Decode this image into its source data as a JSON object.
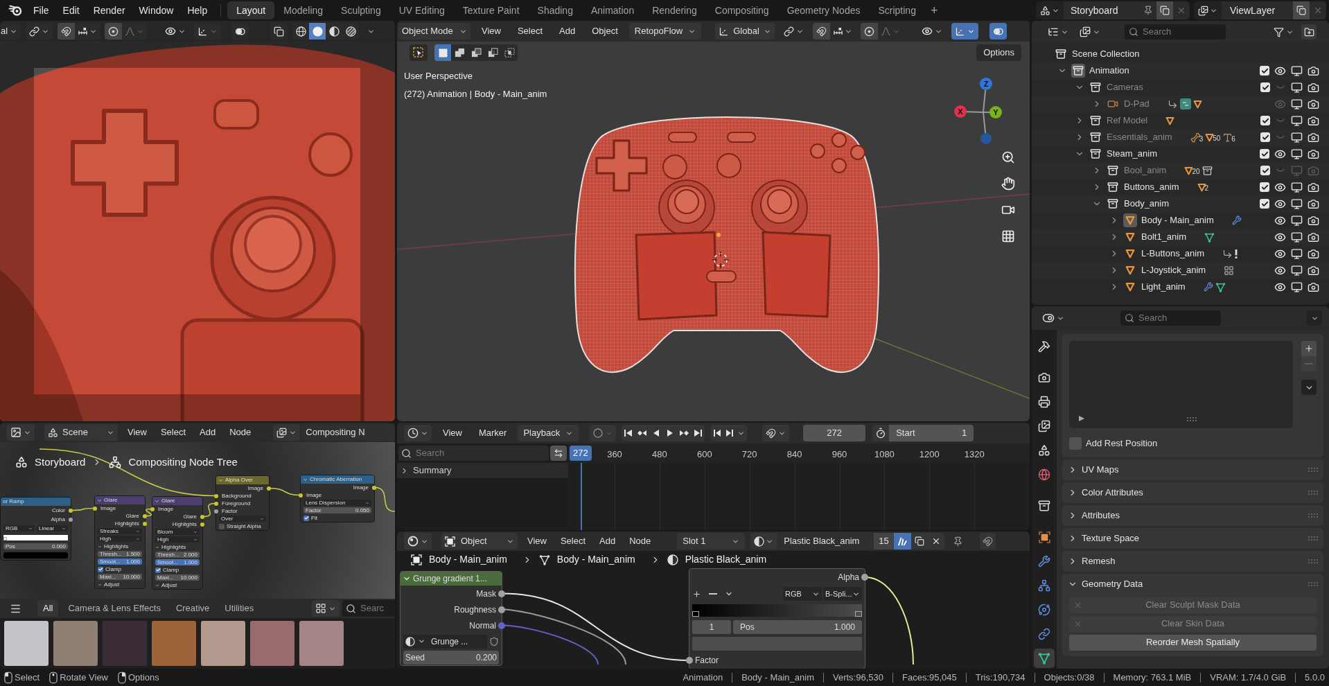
{
  "top_bar": {
    "menus": [
      "File",
      "Edit",
      "Render",
      "Window",
      "Help"
    ],
    "workspaces": [
      {
        "label": "Layout",
        "selected": true
      },
      {
        "label": "Modeling",
        "selected": false
      },
      {
        "label": "Sculpting",
        "selected": false
      },
      {
        "label": "UV Editing",
        "selected": false
      },
      {
        "label": "Texture Paint",
        "selected": false
      },
      {
        "label": "Shading",
        "selected": false
      },
      {
        "label": "Animation",
        "selected": false
      },
      {
        "label": "Rendering",
        "selected": false
      },
      {
        "label": "Compositing",
        "selected": false
      },
      {
        "label": "Geometry Nodes",
        "selected": false
      },
      {
        "label": "Scripting",
        "selected": false
      }
    ],
    "add_workspace": "+",
    "scene": "Storyboard",
    "view_layer": "ViewLayer"
  },
  "camera_view": {
    "orientation": "al",
    "gizmo": false,
    "overlays": false,
    "shading": [
      {
        "kind": "wireframe",
        "selected": false
      },
      {
        "kind": "solid",
        "selected": true
      },
      {
        "kind": "material",
        "selected": false
      },
      {
        "kind": "rendered",
        "selected": false
      }
    ]
  },
  "viewport": {
    "mode": "Object Mode",
    "menus": [
      "View",
      "Select",
      "Add",
      "Object"
    ],
    "addon": "RetopoFlow",
    "orientation": "Global",
    "gizmo": true,
    "overlays": true,
    "select_modes": [
      {
        "kind": "set",
        "selected": true
      },
      {
        "kind": "extend",
        "selected": false
      },
      {
        "kind": "subtract",
        "selected": false
      },
      {
        "kind": "invert",
        "selected": false
      },
      {
        "kind": "intersect",
        "selected": false
      }
    ],
    "options": "Options",
    "view_name": "User Perspective",
    "info": "(272) Animation | Body - Main_anim",
    "axes": [
      {
        "label": "Z",
        "color": "#2f76dc"
      },
      {
        "label": "X",
        "color": "#e0314d"
      },
      {
        "label": "Y",
        "color": "#7ab317"
      }
    ]
  },
  "outliner": {
    "search": {
      "placeholder": "Search"
    },
    "tree": [
      {
        "label": "Scene Collection",
        "kind": "scene_collection",
        "selected": false,
        "children": [
          {
            "label": "Animation",
            "kind": "collection",
            "selected": true,
            "expanded": true,
            "checked": true,
            "visible": true,
            "renderable": true,
            "children": [
              {
                "label": "Cameras",
                "kind": "collection",
                "selected": false,
                "expanded": true,
                "checked": true,
                "visible": false,
                "renderable": true,
                "children": [
                  {
                    "label": "D-Pad",
                    "kind": "camera",
                    "selected": false,
                    "expanded": false,
                    "visible": false,
                    "renderable": true,
                    "extras": [
                      {
                        "kind": "constraint"
                      },
                      {
                        "kind": "camera_data"
                      },
                      {
                        "kind": "mesh"
                      }
                    ]
                  }
                ]
              },
              {
                "label": "Ref Model",
                "kind": "collection",
                "selected": false,
                "expanded": false,
                "checked": true,
                "visible": false,
                "renderable": true,
                "extras": [
                  {
                    "kind": "mesh"
                  }
                ]
              },
              {
                "label": "Essentials_anim",
                "kind": "collection",
                "selected": false,
                "expanded": false,
                "checked": true,
                "visible": false,
                "renderable": true,
                "extras": [
                  {
                    "kind": "armature",
                    "count": "3"
                  },
                  {
                    "kind": "mesh",
                    "count": "50"
                  },
                  {
                    "kind": "text",
                    "count": "6"
                  }
                ]
              },
              {
                "label": "Steam_anim",
                "kind": "collection",
                "selected": false,
                "expanded": true,
                "checked": true,
                "visible": true,
                "renderable": true,
                "children": [
                  {
                    "label": "Bool_anim",
                    "kind": "collection",
                    "selected": false,
                    "expanded": false,
                    "checked": true,
                    "visible": false,
                    "renderable": false,
                    "extras": [
                      {
                        "kind": "mesh",
                        "count": "20"
                      },
                      {
                        "kind": "collection"
                      }
                    ]
                  },
                  {
                    "label": "Buttons_anim",
                    "kind": "collection",
                    "selected": false,
                    "expanded": false,
                    "checked": true,
                    "visible": true,
                    "renderable": true,
                    "extras": [
                      {
                        "kind": "mesh",
                        "count": "2"
                      }
                    ]
                  },
                  {
                    "label": "Body_anim",
                    "kind": "collection",
                    "selected": false,
                    "expanded": true,
                    "checked": true,
                    "visible": true,
                    "renderable": true,
                    "children": [
                      {
                        "label": "Body - Main_anim",
                        "kind": "mesh_object",
                        "selected": true,
                        "expanded": false,
                        "visible": true,
                        "renderable": true,
                        "extras": [
                          {
                            "kind": "modifier"
                          }
                        ]
                      },
                      {
                        "label": "Bolt1_anim",
                        "kind": "mesh_object",
                        "selected": false,
                        "expanded": false,
                        "visible": true,
                        "renderable": true,
                        "extras": [
                          {
                            "kind": "mesh_data"
                          }
                        ]
                      },
                      {
                        "label": "L-Buttons_anim",
                        "kind": "mesh_object",
                        "selected": false,
                        "expanded": false,
                        "visible": true,
                        "renderable": true,
                        "extras": [
                          {
                            "kind": "constraint"
                          },
                          {
                            "kind": "warning"
                          }
                        ]
                      },
                      {
                        "label": "L-Joystick_anim",
                        "kind": "mesh_object",
                        "selected": false,
                        "expanded": false,
                        "visible": true,
                        "renderable": true,
                        "extras": [
                          {
                            "kind": "nodes"
                          }
                        ]
                      },
                      {
                        "label": "Light_anim",
                        "kind": "mesh_object",
                        "selected": false,
                        "expanded": false,
                        "visible": true,
                        "renderable": true,
                        "extras": [
                          {
                            "kind": "modifier"
                          },
                          {
                            "kind": "mesh_data"
                          }
                        ]
                      }
                    ]
                  }
                ]
              }
            ]
          }
        ]
      }
    ]
  },
  "properties": {
    "search": {
      "placeholder": "Search"
    },
    "tabs": [
      {
        "kind": "tool",
        "selected": false
      },
      {
        "kind": "render",
        "selected": false
      },
      {
        "kind": "output",
        "selected": false
      },
      {
        "kind": "view_layer",
        "selected": false
      },
      {
        "kind": "scene",
        "selected": false
      },
      {
        "kind": "world",
        "selected": false
      },
      {
        "kind": "collection",
        "selected": false
      },
      {
        "kind": "object",
        "selected": false
      },
      {
        "kind": "modifiers",
        "selected": false
      },
      {
        "kind": "particles",
        "selected": false
      },
      {
        "kind": "physics",
        "selected": false
      },
      {
        "kind": "constraints",
        "selected": false
      },
      {
        "kind": "data",
        "selected": true
      }
    ],
    "rest_position": {
      "label": "Add Rest Position",
      "checked": false
    },
    "panels": [
      {
        "label": "UV Maps",
        "expanded": false
      },
      {
        "label": "Color Attributes",
        "expanded": false
      },
      {
        "label": "Attributes",
        "expanded": false
      },
      {
        "label": "Texture Space",
        "expanded": false
      },
      {
        "label": "Remesh",
        "expanded": false
      },
      {
        "label": "Geometry Data",
        "expanded": true,
        "buttons": [
          {
            "label": "Clear Sculpt Mask Data",
            "disabled": true
          },
          {
            "label": "Clear Skin Data",
            "disabled": true
          },
          {
            "label": "Reorder Mesh Spatially",
            "disabled": false
          }
        ]
      }
    ]
  },
  "compositor": {
    "scene": "Scene",
    "menus": [
      "View",
      "Select",
      "Add",
      "Node"
    ],
    "tree": "Compositing N",
    "breadcrumb": [
      {
        "kind": "scene",
        "label": "Storyboard"
      },
      {
        "kind": "node_tree",
        "label": "Compositing Node Tree"
      }
    ],
    "nodes": [
      {
        "title": "or Ramp",
        "color": "#2e5f87",
        "rows": [
          {
            "kind": "output",
            "label": "Color",
            "color": "#c7c729"
          },
          {
            "kind": "output",
            "label": "Alpha",
            "color": "#a1a1a1"
          },
          {
            "kind": "dropdowns",
            "labels": [
              "RGB",
              "Linear"
            ]
          },
          {
            "kind": "ramp",
            "stops": [
              {
                "color": "#ffffff"
              }
            ]
          },
          {
            "kind": "field",
            "label": "Pos",
            "value": "0.000",
            "highlight": false
          },
          {
            "kind": "swatch",
            "color": "#000000"
          }
        ]
      },
      {
        "title": "Glare",
        "color": "#4c3f6e",
        "rows": [
          {
            "kind": "input",
            "label": "Image",
            "color": "#c7c729"
          },
          {
            "kind": "output",
            "label": "Glare",
            "color": "#c7c729"
          },
          {
            "kind": "output",
            "label": "Highlights",
            "color": "#c7c729"
          },
          {
            "kind": "dropdown",
            "label": "Streaks"
          },
          {
            "kind": "dropdown",
            "label": "High"
          },
          {
            "kind": "panel",
            "label": "Highlights",
            "expanded": true
          },
          {
            "kind": "field",
            "label": "Thresh...",
            "value": "1.500",
            "highlight": false
          },
          {
            "kind": "field",
            "label": "Smoot...",
            "value": "1.000",
            "highlight": true
          },
          {
            "kind": "checkbox",
            "label": "Clamp",
            "checked": true
          },
          {
            "kind": "field",
            "label": "Maxi...",
            "value": "10.000",
            "highlight": false
          },
          {
            "kind": "panel",
            "label": "Adjust",
            "expanded": true
          }
        ]
      },
      {
        "title": "Glare",
        "color": "#4c3f6e",
        "rows": [
          {
            "kind": "input",
            "label": "Image",
            "color": "#c7c729"
          },
          {
            "kind": "output",
            "label": "Glare",
            "color": "#c7c729"
          },
          {
            "kind": "output",
            "label": "Highlights",
            "color": "#c7c729"
          },
          {
            "kind": "dropdown",
            "label": "Bloom"
          },
          {
            "kind": "dropdown",
            "label": "High"
          },
          {
            "kind": "panel",
            "label": "Highlights",
            "expanded": true
          },
          {
            "kind": "field",
            "label": "Thresh...",
            "value": "2.000",
            "highlight": false
          },
          {
            "kind": "field",
            "label": "Smoot...",
            "value": "1.000",
            "highlight": true
          },
          {
            "kind": "checkbox",
            "label": "Clamp",
            "checked": true
          },
          {
            "kind": "field",
            "label": "Maxi...",
            "value": "10.000",
            "highlight": false
          },
          {
            "kind": "panel",
            "label": "Adjust",
            "expanded": true
          }
        ]
      },
      {
        "title": "Alpha Over",
        "color": "#6b6a2c",
        "rows": [
          {
            "kind": "output",
            "label": "Image",
            "color": "#c7c729"
          },
          {
            "kind": "input",
            "label": "Background",
            "color": "#c7c729"
          },
          {
            "kind": "input",
            "label": "Foreground",
            "color": "#c7c729"
          },
          {
            "kind": "input",
            "label": "Factor",
            "color": "#a1a1a1"
          },
          {
            "kind": "dropdown",
            "label": "Over"
          },
          {
            "kind": "checkbox",
            "label": "Straight Alpha",
            "checked": false
          }
        ]
      },
      {
        "title": "Chromatic Aberration",
        "color": "#2e5f87",
        "rows": [
          {
            "kind": "output",
            "label": "Image",
            "color": "#c7c729"
          },
          {
            "kind": "input",
            "label": "Image",
            "color": "#c7c729"
          },
          {
            "kind": "dropdown",
            "label": "Lens Dispersion"
          },
          {
            "kind": "field",
            "label": "Factor",
            "value": "0.050",
            "highlight": false
          },
          {
            "kind": "checkbox",
            "label": "Fit",
            "checked": true
          }
        ]
      }
    ]
  },
  "asset_browser": {
    "categories": [
      {
        "label": "All",
        "selected": true
      },
      {
        "label": "Camera & Lens Effects",
        "selected": false
      },
      {
        "label": "Creative",
        "selected": false
      },
      {
        "label": "Utilities",
        "selected": false
      }
    ],
    "search": {
      "placeholder": "Searc"
    },
    "assets": [
      {
        "color": "#c4c4c8"
      },
      {
        "color": "#8f7f74"
      },
      {
        "color": "#3b2d38"
      },
      {
        "color": "#9c6438"
      },
      {
        "color": "#b39a8e"
      },
      {
        "color": "#9a6b6e"
      },
      {
        "color": "#a48484"
      }
    ]
  },
  "timeline": {
    "menus": [
      "View",
      "Marker"
    ],
    "playback": "Playback",
    "auto_keying": false,
    "frame": "272",
    "start_label": "Start",
    "start": "1",
    "search": {
      "placeholder": "Search"
    },
    "playhead": "272",
    "ticks": [
      "360",
      "480",
      "600",
      "720",
      "840",
      "960",
      "1080",
      "1200",
      "1320"
    ],
    "channels": [
      {
        "label": "Summary",
        "expanded": false
      }
    ]
  },
  "shader_editor": {
    "context": "Object",
    "menus": [
      "View",
      "Select",
      "Add",
      "Node"
    ],
    "slot": "Slot 1",
    "material": "Plastic Black_anim",
    "users": "15",
    "fake_user": true,
    "breadcrumb": [
      {
        "kind": "object",
        "label": "Body - Main_anim"
      },
      {
        "kind": "mesh",
        "label": "Body - Main_anim"
      },
      {
        "kind": "material",
        "label": "Plastic Black_anim"
      }
    ],
    "nodes": [
      {
        "title": "Grunge gradient 1...",
        "color": "#4a6b3a",
        "rows": [
          {
            "kind": "output",
            "label": "Mask",
            "color": "#a1a1a1"
          },
          {
            "kind": "output",
            "label": "Roughness",
            "color": "#a1a1a1"
          },
          {
            "kind": "output",
            "label": "Normal",
            "color": "#6363c7"
          },
          {
            "kind": "group",
            "label": "Grunge ..."
          },
          {
            "kind": "field",
            "label": "Seed",
            "value": "0.200",
            "highlight": false
          }
        ]
      },
      {
        "rows": [
          {
            "kind": "output",
            "label": "Alpha",
            "color": "#a1a1a1"
          },
          {
            "kind": "ramp_tools",
            "labels": [
              "RGB",
              "B-Spli..."
            ]
          },
          {
            "kind": "ramp",
            "stops": [
              {
                "color": "#000000"
              },
              {
                "color": "#4d4d4d"
              }
            ]
          },
          {
            "kind": "stop_field",
            "index": "1",
            "label": "Pos",
            "value": "1.000"
          },
          {
            "kind": "swatch",
            "color": "#4d4d4d"
          },
          {
            "kind": "input",
            "label": "Factor",
            "color": "#a1a1a1"
          }
        ]
      }
    ]
  },
  "status_bar": {
    "hints": [
      {
        "kind": "left",
        "label": "Select"
      },
      {
        "kind": "middle",
        "label": "Rotate View"
      },
      {
        "kind": "right",
        "label": "Options"
      }
    ],
    "stats": [
      "Animation",
      "Body - Main_anim",
      "Verts:96,530",
      "Faces:95,045",
      "Tris:190,734",
      "Objects:0/38",
      "Memory: 763.1 MiB",
      "VRAM: 1.7/4.0 GiB",
      "5.0.0"
    ]
  }
}
